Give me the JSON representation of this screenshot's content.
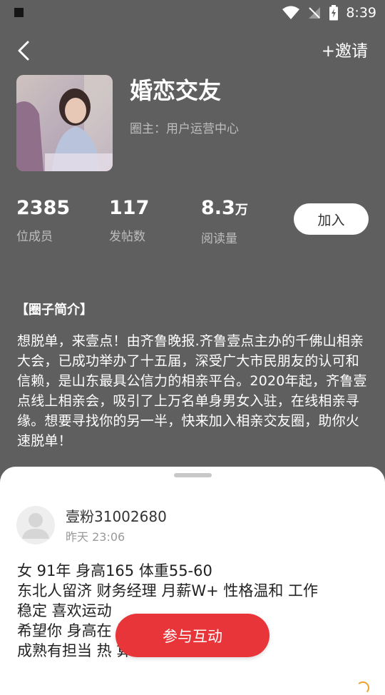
{
  "status_bar": {
    "time": "8:39"
  },
  "header": {
    "invite_label": "+邀请"
  },
  "circle": {
    "title": "婚恋交友",
    "owner": "圈主：用户运营中心",
    "stats": [
      {
        "value": "2385",
        "unit": "",
        "label": "位成员"
      },
      {
        "value": "117",
        "unit": "",
        "label": "发帖数"
      },
      {
        "value": "8.3",
        "unit": "万",
        "label": "阅读量"
      }
    ],
    "join_label": "加入"
  },
  "intro": {
    "heading": "【圈子简介】",
    "text": "想脱单，来壹点！由齐鲁晚报.齐鲁壹点主办的千佛山相亲大会，已成功举办了十五届，深受广大市民朋友的认可和信赖，是山东最具公信力的相亲平台。2020年起，齐鲁壹点线上相亲会，吸引了上万名单身男女入驻，在线相亲寻缘。想要寻找你的另一半，快来加入相亲交友圈，助你火速脱单！"
  },
  "post": {
    "username": "壹粉31002680",
    "time": "昨天 23:06",
    "lines": [
      "女  91年  身高165  体重55-60",
      "东北人留济  财务经理  月薪W+  性格温和  工作",
      "稳定  喜欢运动",
      "希望你 身高在                                岁以下 阳光",
      "成熟有担当  热                           算 无不良嗜好"
    ]
  },
  "participate_label": "参与互动",
  "colors": {
    "background": "#5f5f5f",
    "accent": "#e8353a",
    "sheet": "#ffffff"
  }
}
